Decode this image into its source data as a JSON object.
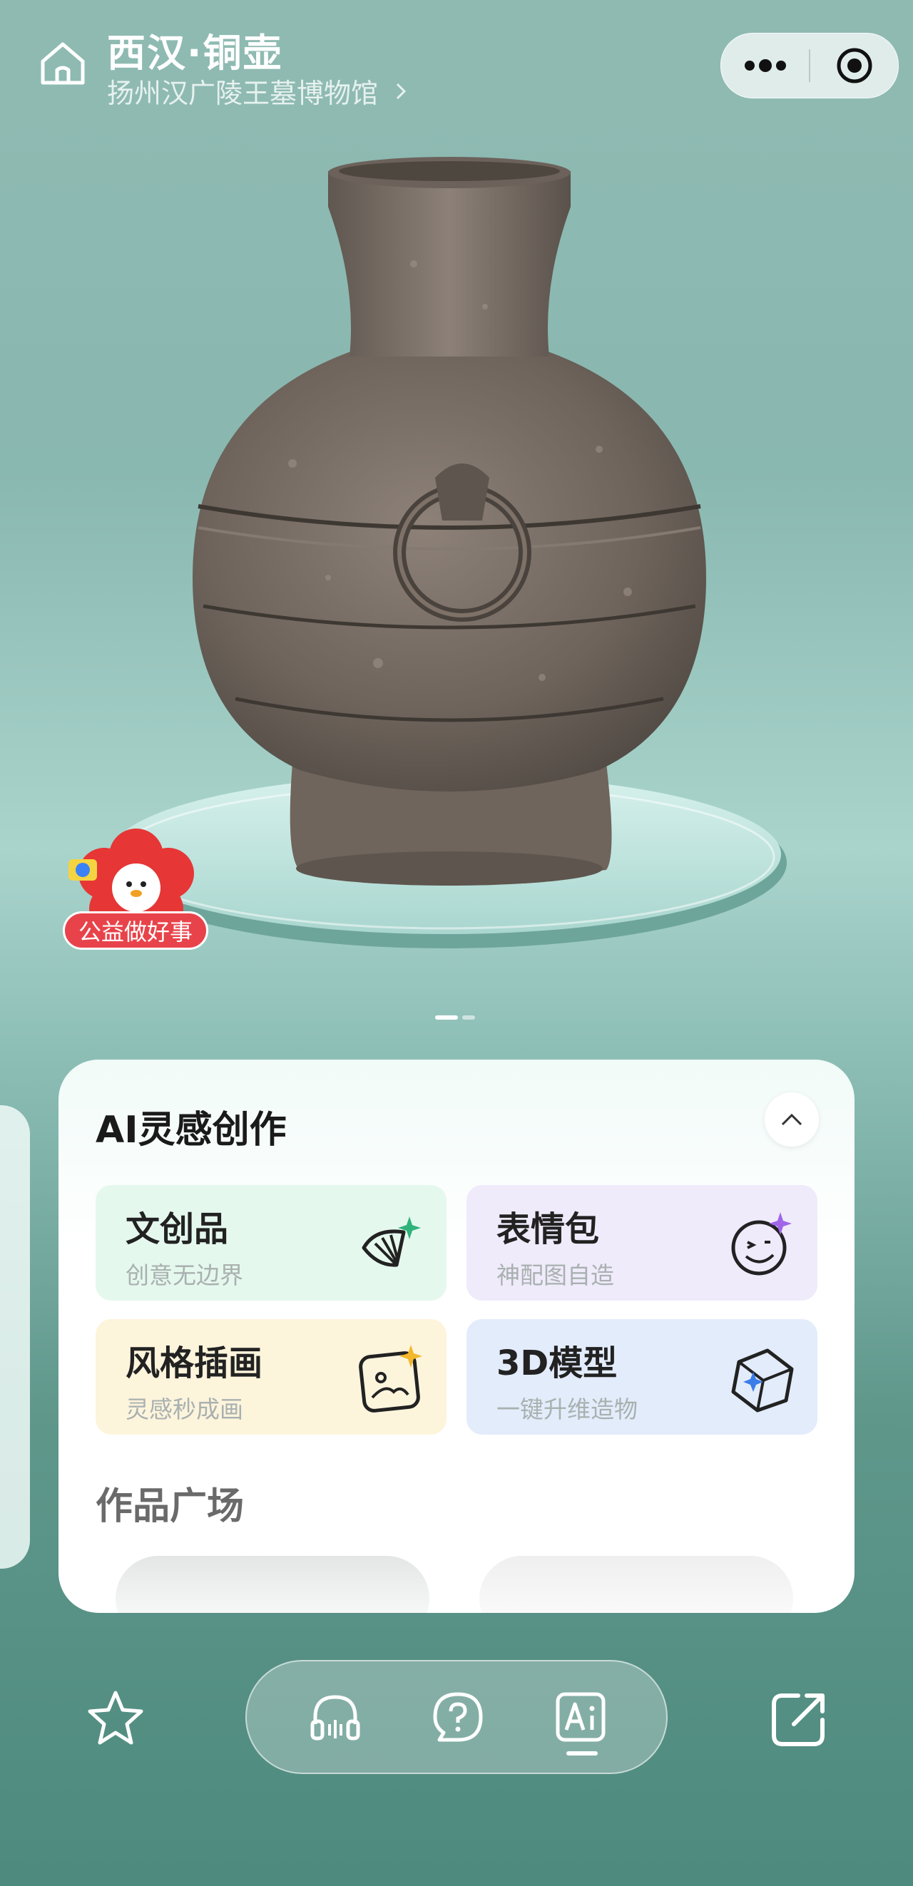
{
  "header": {
    "title": "西汉·铜壶",
    "subtitle": "扬州汉广陵王墓博物馆"
  },
  "badge": {
    "label": "公益做好事"
  },
  "carousel": {
    "pages": 2,
    "current": 1
  },
  "ai_panel": {
    "title": "AI灵感创作",
    "cards": [
      {
        "title": "文创品",
        "subtitle": "创意无边界",
        "icon": "fan-sparkle-icon",
        "color": "#e5f8ee"
      },
      {
        "title": "表情包",
        "subtitle": "神配图自造",
        "icon": "face-sparkle-icon",
        "color": "#efebfb"
      },
      {
        "title": "风格插画",
        "subtitle": "灵感秒成画",
        "icon": "picture-sparkle-icon",
        "color": "#fdf4dc"
      },
      {
        "title": "3D模型",
        "subtitle": "一键升维造物",
        "icon": "cube-sparkle-icon",
        "color": "#e3ecfb"
      }
    ],
    "gallery_title": "作品广场"
  },
  "bottom_bar": {
    "left": "star-icon",
    "center": [
      "audio-guide-icon",
      "question-icon",
      "ai-icon"
    ],
    "active": "ai-icon",
    "right": "share-icon"
  }
}
